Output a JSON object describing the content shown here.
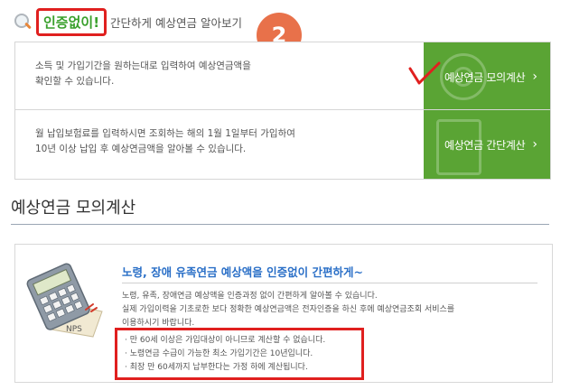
{
  "header": {
    "badge": "인증없이!",
    "subtitle": "간단하게 예상연금 알아보기",
    "step_number": "2"
  },
  "options": [
    {
      "description_lines": [
        "소득 및 가입기간을 원하는대로 입력하여 예상연금액을",
        "확인할 수 있습니다."
      ],
      "button_label": "예상연금 모의계산",
      "icon": "target-icon"
    },
    {
      "description_lines": [
        "월 납입보험료를 입력하시면 조회하는 해의 1월 1일부터 가입하여",
        "10년 이상 납입 후 예상연금액을 알아볼 수 있습니다."
      ],
      "button_label": "예상연금 간단계산",
      "icon": "calculator-icon"
    }
  ],
  "section": {
    "title": "예상연금 모의계산"
  },
  "info": {
    "title": "노령, 장애 유족연금 예상액을 인증없이 간편하게~",
    "body_lines": [
      "노령, 유족, 장애연금 예상액을 인증과정 없이 간편하게 알아볼 수 있습니다.",
      "실제 가입이력을 기초로한 보다 정확한 예상연금액은 전자인증을 하신 후에 예상연금조회 서비스를",
      "이용하시기 바랍니다."
    ],
    "notes": [
      "· 만 60세 이상은 가입대상이 아니므로 계산할 수 없습니다.",
      "· 노령연금 수급이 가능한 최소 가입기간은 10년입니다.",
      "· 최장 만 60세까지 납부한다는 가정 하에 계산됩니다."
    ],
    "image_label": "NPS"
  },
  "colors": {
    "green": "#5aa434",
    "highlight_red": "#e0201f",
    "step_orange": "#e8714a",
    "title_blue": "#2a6fc7"
  }
}
